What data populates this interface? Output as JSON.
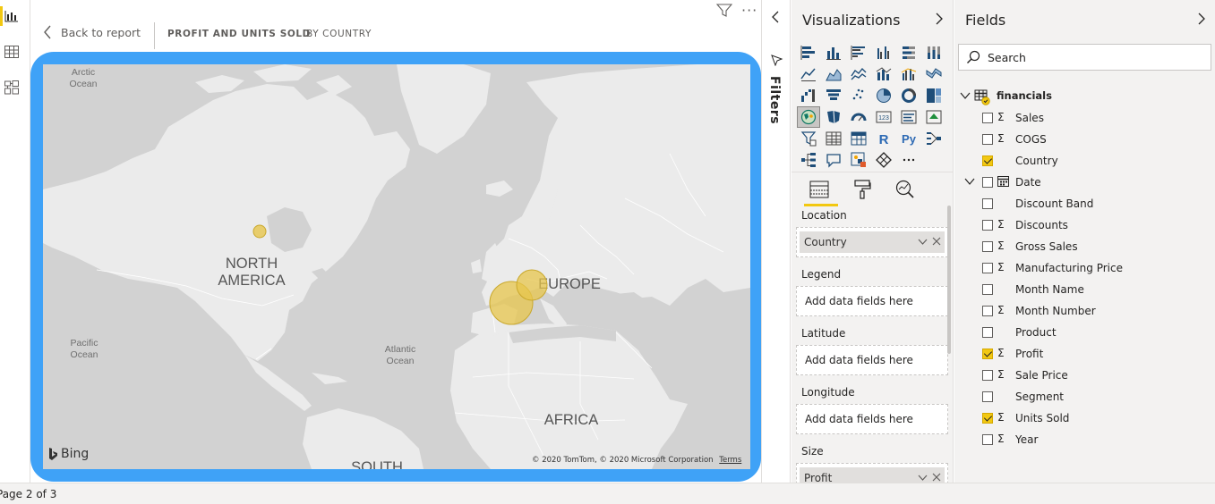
{
  "report": {
    "back_label": "Back to report",
    "breadcrumb_title": "PROFIT AND UNITS SOLD",
    "breadcrumb_sub": "BY COUNTRY"
  },
  "map": {
    "labels": {
      "arctic": "Arctic\nOcean",
      "north_america": "NORTH\nAMERICA",
      "europe": "EUROPE",
      "pacific": "Pacific\nOcean",
      "atlantic": "Atlantic\nOcean",
      "africa": "AFRICA",
      "south": "SOUTH"
    },
    "bing_label": "Bing",
    "attribution": "© 2020 TomTom, © 2020 Microsoft Corporation",
    "terms_label": "Terms",
    "bubble_color": "#e7c54c",
    "frame_color": "#3fa2f7"
  },
  "status": {
    "page": "Page 2 of 3"
  },
  "filters_pane": {
    "label": "Filters"
  },
  "visualizations": {
    "title": "Visualizations",
    "wells": [
      {
        "label": "Location",
        "value": "Country",
        "filled": true
      },
      {
        "label": "Legend",
        "value": "Add data fields here",
        "filled": false
      },
      {
        "label": "Latitude",
        "value": "Add data fields here",
        "filled": false
      },
      {
        "label": "Longitude",
        "value": "Add data fields here",
        "filled": false
      },
      {
        "label": "Size",
        "value": "Profit",
        "filled": true
      }
    ],
    "icons": [
      "stacked-bar-chart-icon",
      "stacked-column-chart-icon",
      "clustered-bar-chart-icon",
      "clustered-column-chart-icon",
      "100-stacked-bar-chart-icon",
      "100-stacked-column-chart-icon",
      "line-chart-icon",
      "area-chart-icon",
      "stacked-area-chart-icon",
      "line-and-stacked-column-chart-icon",
      "line-and-clustered-column-chart-icon",
      "ribbon-chart-icon",
      "waterfall-chart-icon",
      "funnel-chart-icon",
      "scatter-chart-icon",
      "pie-chart-icon",
      "donut-chart-icon",
      "treemap-icon",
      "map-icon",
      "filled-map-icon",
      "gauge-icon",
      "card-icon",
      "multi-row-card-icon",
      "kpi-icon",
      "slicer-icon",
      "table-icon",
      "matrix-icon",
      "r-visual-icon",
      "python-visual-icon",
      "key-influencers-icon",
      "decomposition-tree-icon",
      "qa-icon",
      "custom-visual-icon",
      "arcgis-icon",
      "more-visuals-icon"
    ],
    "tabs": [
      "fields-tab-icon",
      "format-tab-icon",
      "analytics-tab-icon"
    ]
  },
  "fields": {
    "title": "Fields",
    "search_placeholder": "Search",
    "table_name": "financials",
    "items": [
      {
        "name": "Sales",
        "sigma": true,
        "checked": false
      },
      {
        "name": "COGS",
        "sigma": true,
        "checked": false
      },
      {
        "name": "Country",
        "sigma": false,
        "checked": true
      },
      {
        "name": "Date",
        "sigma": false,
        "checked": false,
        "hierarchy": true
      },
      {
        "name": "Discount Band",
        "sigma": false,
        "checked": false
      },
      {
        "name": "Discounts",
        "sigma": true,
        "checked": false
      },
      {
        "name": "Gross Sales",
        "sigma": true,
        "checked": false
      },
      {
        "name": "Manufacturing Price",
        "sigma": true,
        "checked": false
      },
      {
        "name": "Month Name",
        "sigma": false,
        "checked": false
      },
      {
        "name": "Month Number",
        "sigma": true,
        "checked": false
      },
      {
        "name": "Product",
        "sigma": false,
        "checked": false
      },
      {
        "name": "Profit",
        "sigma": true,
        "checked": true
      },
      {
        "name": "Sale Price",
        "sigma": true,
        "checked": false
      },
      {
        "name": "Segment",
        "sigma": false,
        "checked": false
      },
      {
        "name": "Units Sold",
        "sigma": true,
        "checked": true
      },
      {
        "name": "Year",
        "sigma": true,
        "checked": false
      }
    ]
  }
}
